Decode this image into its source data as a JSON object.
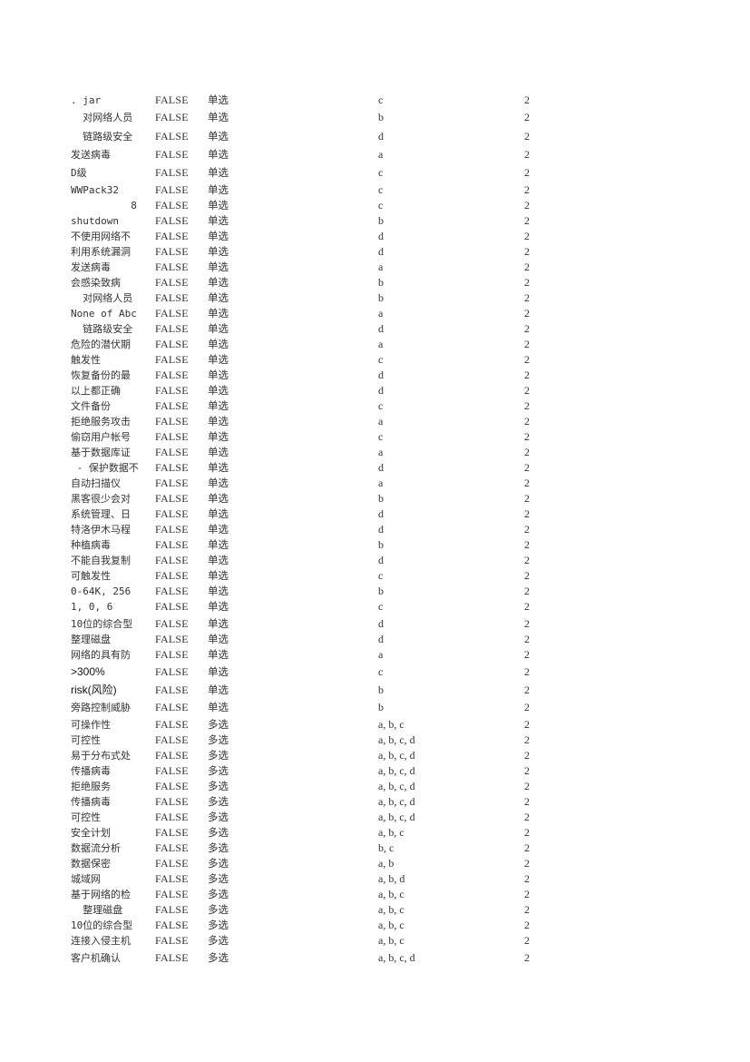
{
  "sheet": {
    "rows": [
      {
        "option": ". jar",
        "flag": "FALSE",
        "type": "单选",
        "answer": "c",
        "score": "2"
      },
      {
        "option": "  对网络人员",
        "flag": "FALSE",
        "type": "单选",
        "answer": "b",
        "score": "2"
      },
      {
        "option": "  链路级安全",
        "flag": "FALSE",
        "type": "单选",
        "answer": "d",
        "score": "2"
      },
      {
        "option": "发送病毒",
        "flag": "FALSE",
        "type": "单选",
        "answer": "a",
        "score": "2"
      },
      {
        "option": "D级",
        "flag": "FALSE",
        "type": "单选",
        "answer": "c",
        "score": "2"
      },
      {
        "option": "WWPack32",
        "flag": "FALSE",
        "type": "单选",
        "answer": "c",
        "score": "2"
      },
      {
        "option": "          8",
        "flag": "FALSE",
        "type": "单选",
        "answer": "c",
        "score": "2"
      },
      {
        "option": "shutdown",
        "flag": "FALSE",
        "type": "单选",
        "answer": "b",
        "score": "2"
      },
      {
        "option": "不使用网络不",
        "flag": "FALSE",
        "type": "单选",
        "answer": "d",
        "score": "2"
      },
      {
        "option": "利用系统漏洞",
        "flag": "FALSE",
        "type": "单选",
        "answer": "d",
        "score": "2"
      },
      {
        "option": "发送病毒",
        "flag": "FALSE",
        "type": "单选",
        "answer": "a",
        "score": "2"
      },
      {
        "option": "会感染致病",
        "flag": "FALSE",
        "type": "单选",
        "answer": "b",
        "score": "2"
      },
      {
        "option": "  对网络人员",
        "flag": "FALSE",
        "type": "单选",
        "answer": "b",
        "score": "2"
      },
      {
        "option": "None of Abc",
        "flag": "FALSE",
        "type": "单选",
        "answer": "a",
        "score": "2"
      },
      {
        "option": "  链路级安全",
        "flag": "FALSE",
        "type": "单选",
        "answer": "d",
        "score": "2"
      },
      {
        "option": "危险的潜伏期",
        "flag": "FALSE",
        "type": "单选",
        "answer": "a",
        "score": "2"
      },
      {
        "option": "触发性",
        "flag": "FALSE",
        "type": "单选",
        "answer": "c",
        "score": "2"
      },
      {
        "option": "恢复备份的最",
        "flag": "FALSE",
        "type": "单选",
        "answer": "d",
        "score": "2"
      },
      {
        "option": "以上都正确",
        "flag": "FALSE",
        "type": "单选",
        "answer": "d",
        "score": "2"
      },
      {
        "option": "文件备份",
        "flag": "FALSE",
        "type": "单选",
        "answer": "c",
        "score": "2"
      },
      {
        "option": "拒绝服务攻击",
        "flag": "FALSE",
        "type": "单选",
        "answer": "a",
        "score": "2"
      },
      {
        "option": "偷窃用户帐号",
        "flag": "FALSE",
        "type": "单选",
        "answer": "c",
        "score": "2"
      },
      {
        "option": "基于数据库证",
        "flag": "FALSE",
        "type": "单选",
        "answer": "a",
        "score": "2"
      },
      {
        "option": " - 保护数据不",
        "flag": "FALSE",
        "type": "单选",
        "answer": "d",
        "score": "2"
      },
      {
        "option": "自动扫描仪",
        "flag": "FALSE",
        "type": "单选",
        "answer": "a",
        "score": "2"
      },
      {
        "option": "黑客很少会对",
        "flag": "FALSE",
        "type": "单选",
        "answer": "b",
        "score": "2"
      },
      {
        "option": "系统管理、日",
        "flag": "FALSE",
        "type": "单选",
        "answer": "d",
        "score": "2"
      },
      {
        "option": "特洛伊木马程",
        "flag": "FALSE",
        "type": "单选",
        "answer": "d",
        "score": "2"
      },
      {
        "option": "种植病毒",
        "flag": "FALSE",
        "type": "单选",
        "answer": "b",
        "score": "2"
      },
      {
        "option": "不能自我复制",
        "flag": "FALSE",
        "type": "单选",
        "answer": "d",
        "score": "2"
      },
      {
        "option": "可触发性",
        "flag": "FALSE",
        "type": "单选",
        "answer": "c",
        "score": "2"
      },
      {
        "option": "0-64K, 256",
        "flag": "FALSE",
        "type": "单选",
        "answer": "b",
        "score": "2"
      },
      {
        "option": "1, 0, 6",
        "flag": "FALSE",
        "type": "单选",
        "answer": "c",
        "score": "2"
      },
      {
        "option": "10位的综合型",
        "flag": "FALSE",
        "type": "单选",
        "answer": "d",
        "score": "2"
      },
      {
        "option": "整理磁盘",
        "flag": "FALSE",
        "type": "单选",
        "answer": "d",
        "score": "2"
      },
      {
        "option": "网络的具有防",
        "flag": "FALSE",
        "type": "单选",
        "answer": "a",
        "score": "2"
      },
      {
        "option": ">300%",
        "flag": "FALSE",
        "type": "单选",
        "answer": "c",
        "score": "2",
        "sans": true
      },
      {
        "option": "risk(风险)",
        "flag": "FALSE",
        "type": "单选",
        "answer": "b",
        "score": "2",
        "sans": true
      },
      {
        "option": "旁路控制威胁",
        "flag": "FALSE",
        "type": "单选",
        "answer": "b",
        "score": "2"
      },
      {
        "option": "可操作性",
        "flag": "FALSE",
        "type": "多选",
        "answer": "a, b, c",
        "score": "2"
      },
      {
        "option": "可控性",
        "flag": "FALSE",
        "type": "多选",
        "answer": "a, b, c, d",
        "score": "2"
      },
      {
        "option": "易于分布式处",
        "flag": "FALSE",
        "type": "多选",
        "answer": "a, b, c, d",
        "score": "2"
      },
      {
        "option": "传播病毒",
        "flag": "FALSE",
        "type": "多选",
        "answer": "a, b, c, d",
        "score": "2"
      },
      {
        "option": "拒绝服务",
        "flag": "FALSE",
        "type": "多选",
        "answer": "a, b, c, d",
        "score": "2"
      },
      {
        "option": "传播病毒",
        "flag": "FALSE",
        "type": "多选",
        "answer": "a, b, c, d",
        "score": "2"
      },
      {
        "option": "可控性",
        "flag": "FALSE",
        "type": "多选",
        "answer": "a, b, c, d",
        "score": "2"
      },
      {
        "option": "安全计划",
        "flag": "FALSE",
        "type": "多选",
        "answer": "a, b, c",
        "score": "2"
      },
      {
        "option": "数据流分析",
        "flag": "FALSE",
        "type": "多选",
        "answer": "b, c",
        "score": "2"
      },
      {
        "option": "数据保密",
        "flag": "FALSE",
        "type": "多选",
        "answer": "a, b",
        "score": "2"
      },
      {
        "option": "城域网",
        "flag": "FALSE",
        "type": "多选",
        "answer": "a, b, d",
        "score": "2"
      },
      {
        "option": "基于网络的检",
        "flag": "FALSE",
        "type": "多选",
        "answer": "a, b, c",
        "score": "2"
      },
      {
        "option": "  整理磁盘",
        "flag": "FALSE",
        "type": "多选",
        "answer": "a, b, c",
        "score": "2"
      },
      {
        "option": "10位的综合型",
        "flag": "FALSE",
        "type": "多选",
        "answer": "a, b, c",
        "score": "2"
      },
      {
        "option": "连接入侵主机",
        "flag": "FALSE",
        "type": "多选",
        "answer": "a, b, c",
        "score": "2"
      },
      {
        "option": "客户机确认",
        "flag": "FALSE",
        "type": "多选",
        "answer": "a, b, c, d",
        "score": "2"
      }
    ]
  }
}
